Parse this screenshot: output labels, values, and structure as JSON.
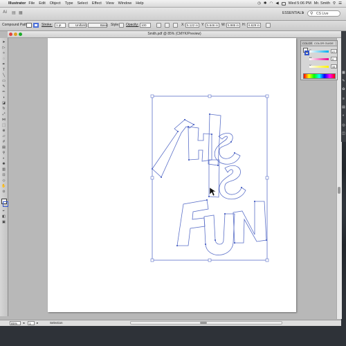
{
  "menubar": {
    "app_name": "Illustrator",
    "items": [
      "File",
      "Edit",
      "Object",
      "Type",
      "Select",
      "Effect",
      "View",
      "Window",
      "Help"
    ],
    "clock": "Wed 5:06 PM",
    "user": "Mr. Smith"
  },
  "appbar": {
    "logo": "Ai",
    "workspace": "ESSENTIALS",
    "search_placeholder": "CS Live"
  },
  "controlbar": {
    "selection_type": "Compound Path",
    "stroke_label": "Stroke:",
    "stroke_weight": "1 pt",
    "variable_width": "Uniform",
    "brush": "Basic",
    "style_label": "Style:",
    "opacity_label": "Opacity:",
    "opacity": "100",
    "x": "5.122 in",
    "y": "5.646 in",
    "w": "5.985 in",
    "h": "6.629 in"
  },
  "document": {
    "title": "Smith.pdf @ 85% (CMYK/Preview)"
  },
  "statusbar": {
    "zoom": "85%",
    "page": "1",
    "tool": "Selection"
  },
  "color_panel": {
    "tabs": [
      "COLOR",
      "COLOR GUIDE"
    ],
    "channels": [
      {
        "name": "C",
        "value": "27"
      },
      {
        "name": "M",
        "value": "0"
      },
      {
        "name": "Y",
        "value": "34"
      }
    ]
  },
  "colors": {
    "selection_blue": "#5a6fc8",
    "artboard": "#ffffff",
    "pasteboard": "#b8b8b8"
  }
}
